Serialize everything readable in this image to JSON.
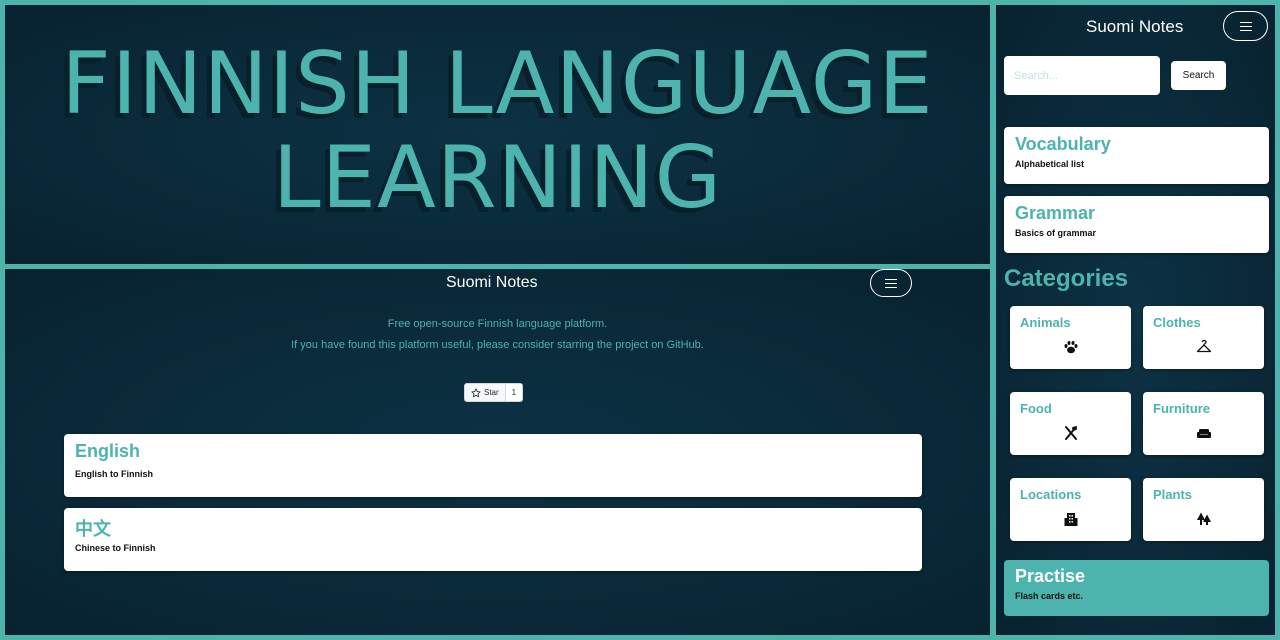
{
  "hero": {
    "title_line1": "FINNISH LANGUAGE",
    "title_line2": "LEARNING"
  },
  "home": {
    "nav_title": "Suomi Notes",
    "tagline1": "Free open-source Finnish language platform.",
    "tagline2": "If you have found this platform useful, please consider starring the project on GitHub.",
    "star_label": "Star",
    "star_count": "1",
    "languages": [
      {
        "title": "English",
        "subtitle": "English to Finnish"
      },
      {
        "title": "中文",
        "subtitle": "Chinese to Finnish"
      }
    ]
  },
  "sidebar": {
    "nav_title": "Suomi Notes",
    "search_placeholder": "Search...",
    "search_button": "Search",
    "vocabulary": {
      "title": "Vocabulary",
      "subtitle": "Alphabetical list"
    },
    "grammar": {
      "title": "Grammar",
      "subtitle": "Basics of grammar"
    },
    "categories_heading": "Categories",
    "categories": [
      {
        "label": "Animals",
        "icon": "paw-icon"
      },
      {
        "label": "Clothes",
        "icon": "hanger-icon"
      },
      {
        "label": "Food",
        "icon": "utensils-icon"
      },
      {
        "label": "Furniture",
        "icon": "couch-icon"
      },
      {
        "label": "Locations",
        "icon": "building-icon"
      },
      {
        "label": "Plants",
        "icon": "trees-icon"
      }
    ],
    "practise": {
      "title": "Practise",
      "subtitle": "Flash cards etc."
    }
  },
  "colors": {
    "accent": "#4cb3ad",
    "panel_bg": "#0a2a39",
    "card_bg": "#ffffff"
  }
}
